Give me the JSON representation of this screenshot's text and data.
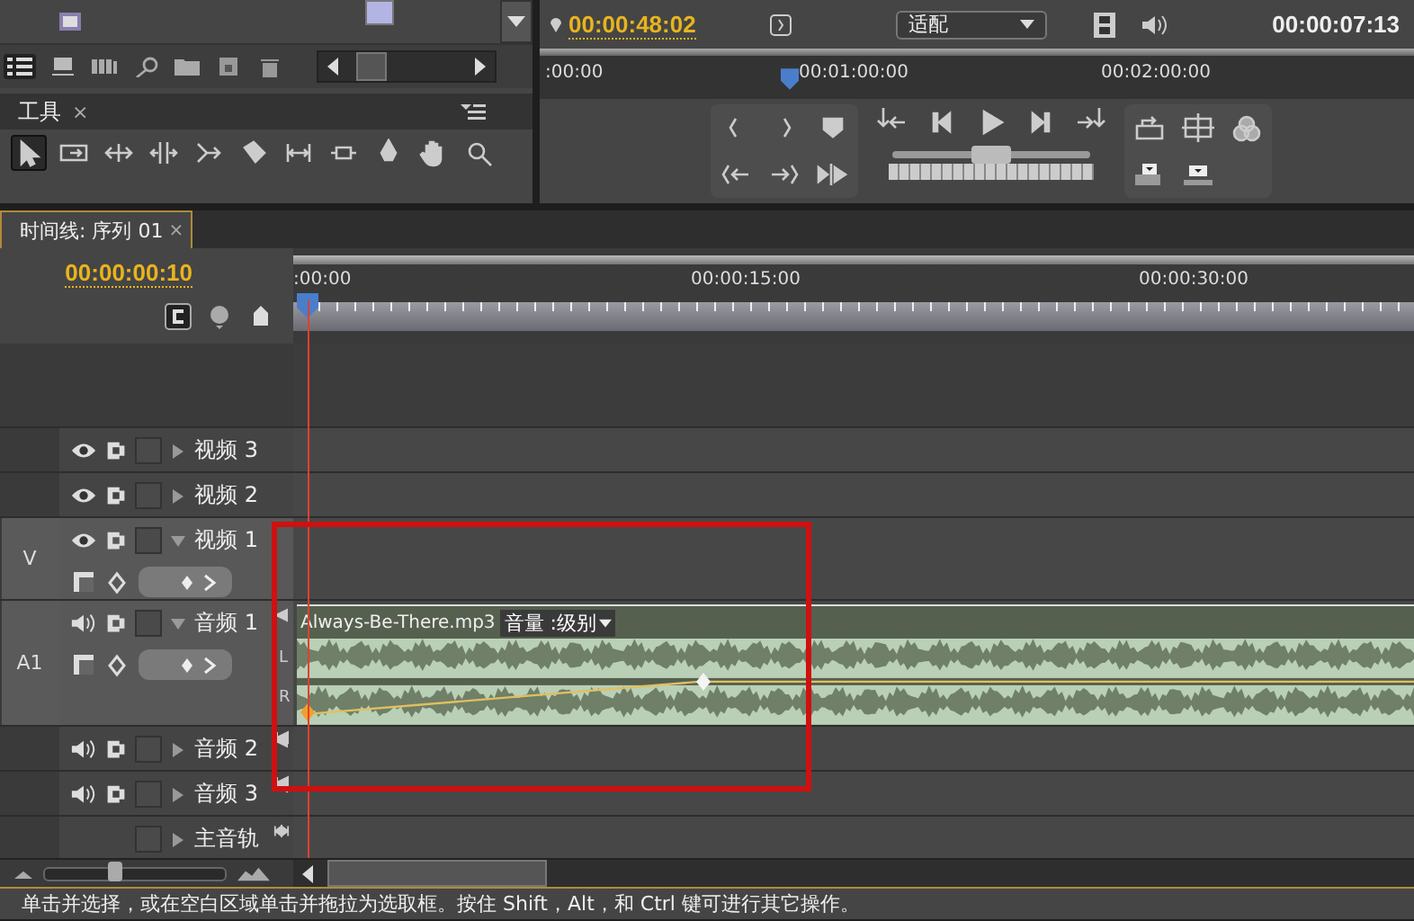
{
  "tools_panel": {
    "title": "工具",
    "close": "×",
    "tools": [
      {
        "kind": "selection",
        "selected": true
      },
      {
        "kind": "track-select",
        "selected": false
      },
      {
        "kind": "ripple",
        "selected": false
      },
      {
        "kind": "rolling",
        "selected": false
      },
      {
        "kind": "rate-stretch",
        "selected": false
      },
      {
        "kind": "razor",
        "selected": false
      },
      {
        "kind": "slip",
        "selected": false
      },
      {
        "kind": "slide",
        "selected": false
      },
      {
        "kind": "pen",
        "selected": false
      },
      {
        "kind": "hand",
        "selected": false
      },
      {
        "kind": "zoom",
        "selected": false
      }
    ]
  },
  "program_monitor": {
    "current_time": "00:00:48:02",
    "zoom": "适配",
    "duration": "00:00:07:13",
    "ruler": [
      ":00:00",
      "00:01:00:00",
      "00:02:00:00"
    ],
    "shuttle": {
      "level": 0.5
    }
  },
  "timeline": {
    "tab": {
      "title": "时间线: 序列 01",
      "close": "×",
      "selected": true
    },
    "current_time": "00:00:00:10",
    "ruler": [
      ":00:00",
      "00:00:15:00",
      "00:00:30:00"
    ],
    "tracks": [
      {
        "kind": "video",
        "name": "视频 3",
        "expanded": false
      },
      {
        "kind": "video",
        "name": "视频 2",
        "expanded": false
      },
      {
        "kind": "video",
        "name": "视频 1",
        "expanded": true,
        "source": "V"
      },
      {
        "kind": "audio",
        "name": "音频 1",
        "expanded": true,
        "source": "A1",
        "clip": {
          "name": "Always-Be-There.mp3",
          "effect": "音量 :级别",
          "channels": [
            "L",
            "R"
          ]
        }
      },
      {
        "kind": "audio",
        "name": "音频 2",
        "expanded": false
      },
      {
        "kind": "audio",
        "name": "音频 3",
        "expanded": false
      },
      {
        "kind": "master",
        "name": "主音轨",
        "expanded": false
      }
    ],
    "zoom_slider": {
      "level": 0.38
    }
  },
  "status_bar": "单击并选择，或在空白区域单击并拖拉为选取框。按住 Shift，Alt，和 Ctrl 键可进行其它操作。"
}
